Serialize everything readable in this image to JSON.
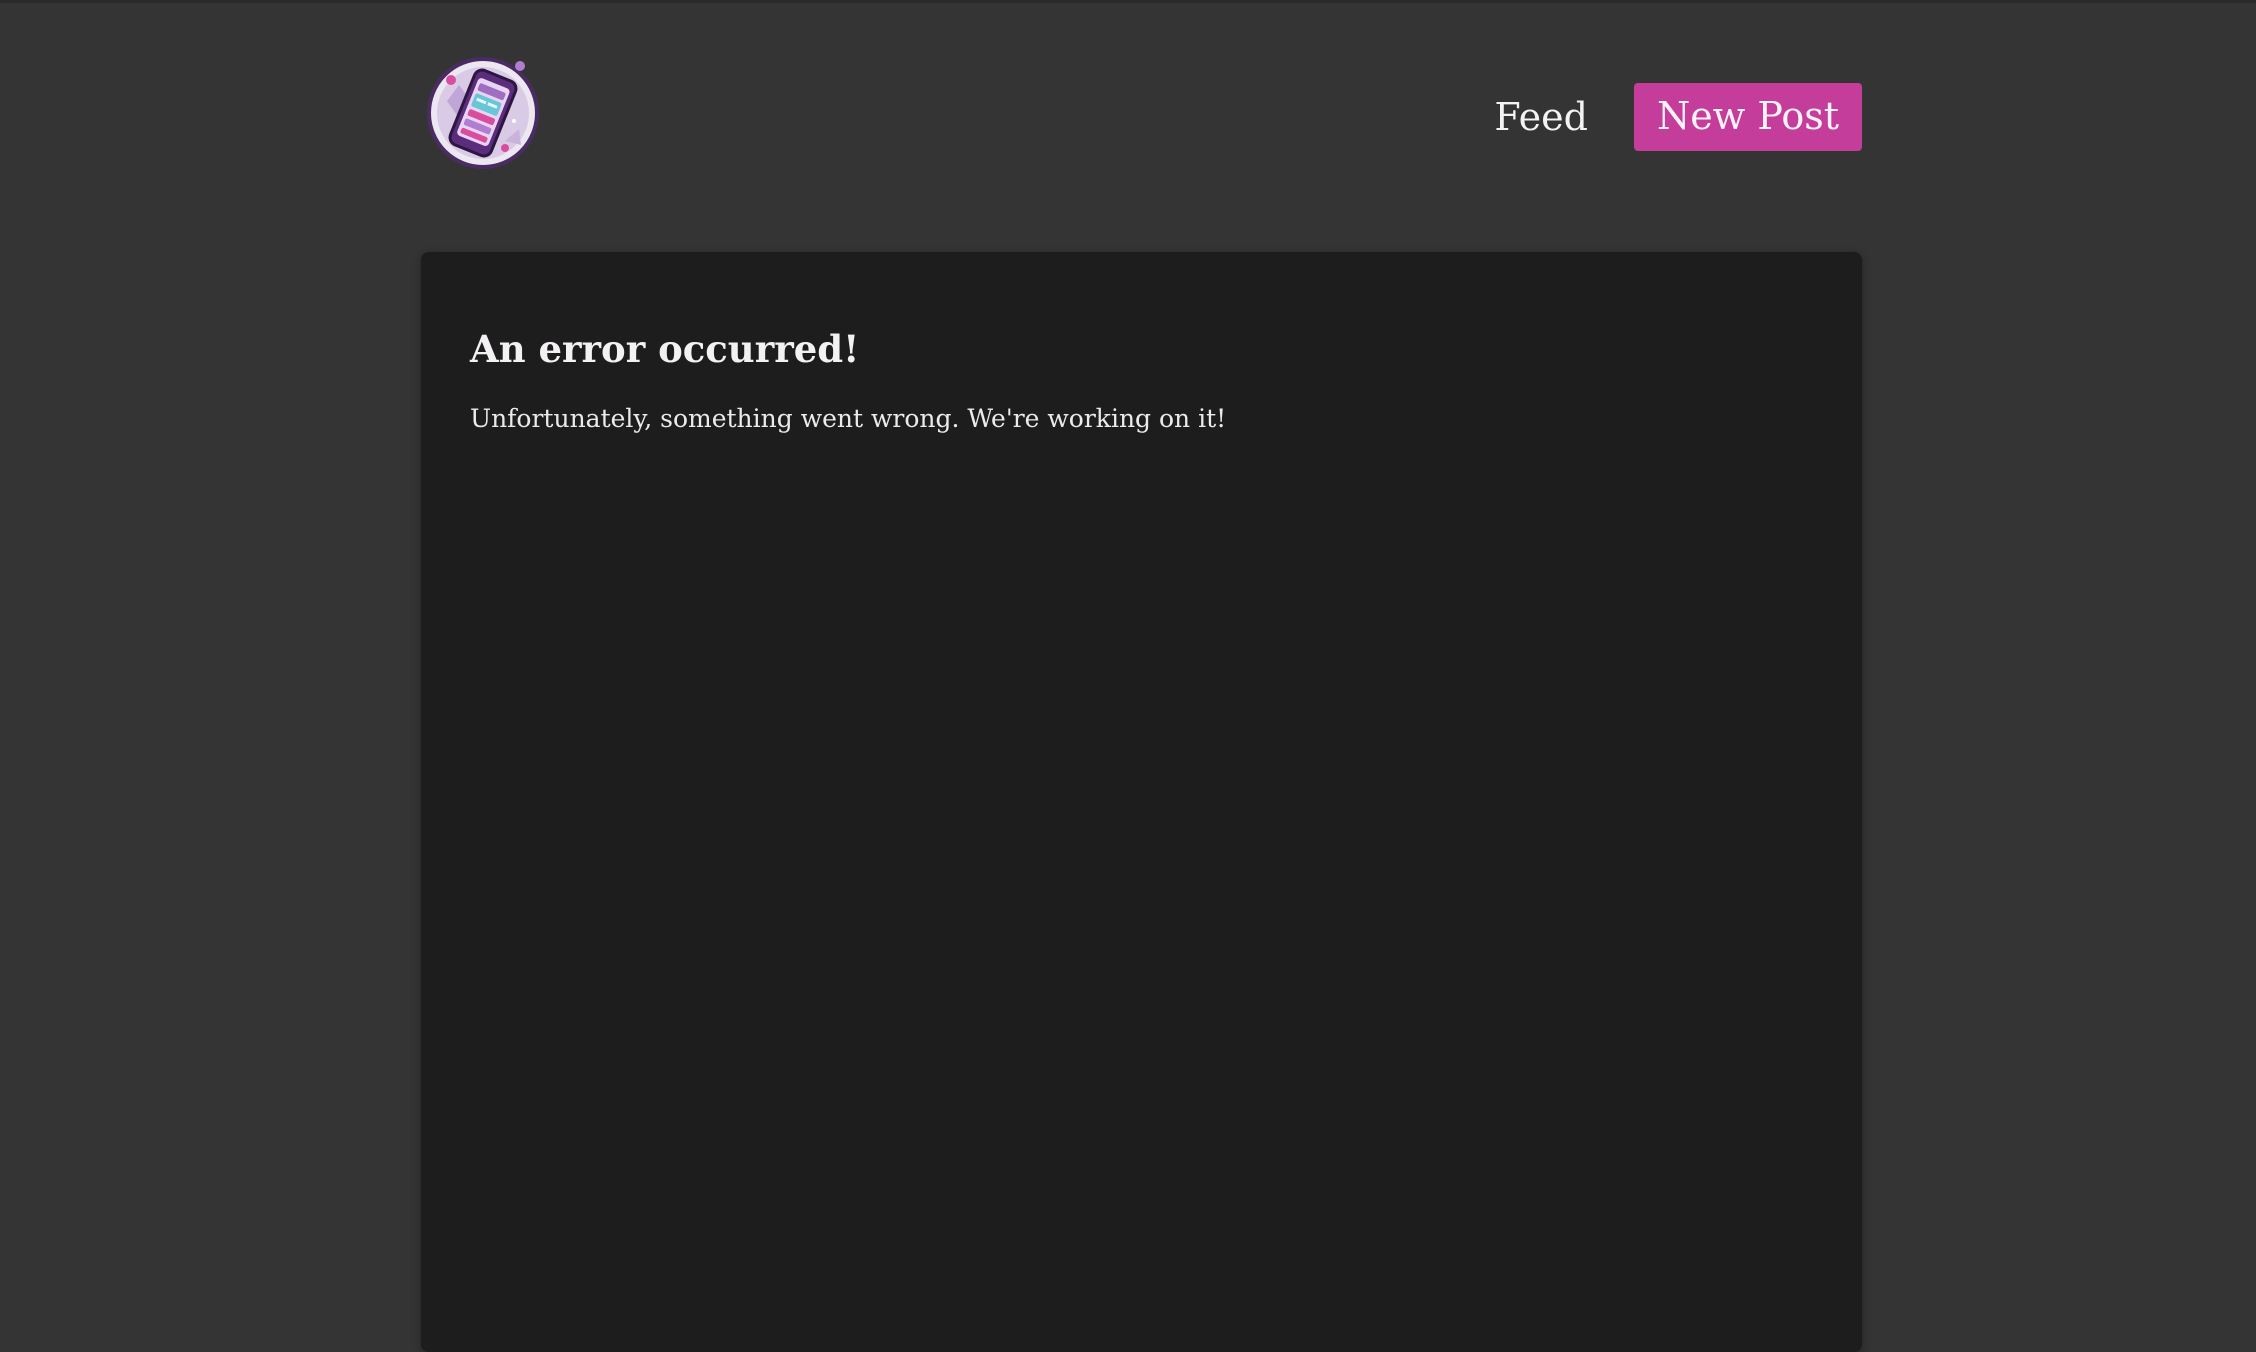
{
  "header": {
    "logo_icon": "phone-app-logo-icon",
    "nav": {
      "feed_label": "Feed",
      "new_post_label": "New Post"
    }
  },
  "main": {
    "error_title": "An error occurred!",
    "error_message": "Unfortunately, something went wrong. We're working on it!"
  },
  "colors": {
    "page_background": "#353435",
    "card_background": "#1e1d1e",
    "accent": "#c43d9a",
    "text": "#f1f0f2"
  }
}
